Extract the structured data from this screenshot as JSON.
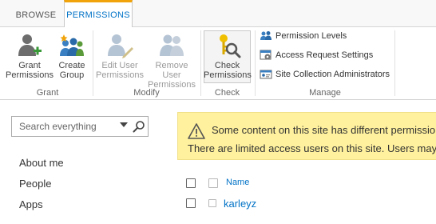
{
  "ribbon": {
    "tabs": [
      {
        "label": "BROWSE"
      },
      {
        "label": "PERMISSIONS"
      }
    ],
    "grant_group": {
      "label": "Grant",
      "grant_permissions": {
        "line1": "Grant",
        "line2": "Permissions"
      },
      "create_group": {
        "line1": "Create",
        "line2": "Group"
      }
    },
    "modify_group": {
      "label": "Modify",
      "edit_user_permissions": {
        "line1": "Edit User",
        "line2": "Permissions"
      },
      "remove_user_permissions": {
        "line1": "Remove User",
        "line2": "Permissions"
      }
    },
    "check_group": {
      "label": "Check",
      "check_permissions": {
        "line1": "Check",
        "line2": "Permissions"
      }
    },
    "manage_group": {
      "label": "Manage",
      "items": [
        {
          "label": "Permission Levels",
          "icon": "permission-levels-icon"
        },
        {
          "label": "Access Request Settings",
          "icon": "access-request-settings-icon"
        },
        {
          "label": "Site Collection Administrators",
          "icon": "site-collection-admins-icon"
        }
      ]
    }
  },
  "search": {
    "placeholder": "Search everything"
  },
  "nav": {
    "items": [
      {
        "label": "About me"
      },
      {
        "label": "People"
      },
      {
        "label": "Apps"
      }
    ]
  },
  "warning": {
    "line1": "Some content on this site has different permissio",
    "line2": "There are limited access users on this site. Users may h"
  },
  "list": {
    "column_name": "Name",
    "rows": [
      {
        "name": "karleyz"
      }
    ]
  },
  "colors": {
    "accent": "#0072c6",
    "tab_highlight": "#f0a30a",
    "warning_bg": "#fff19d"
  }
}
